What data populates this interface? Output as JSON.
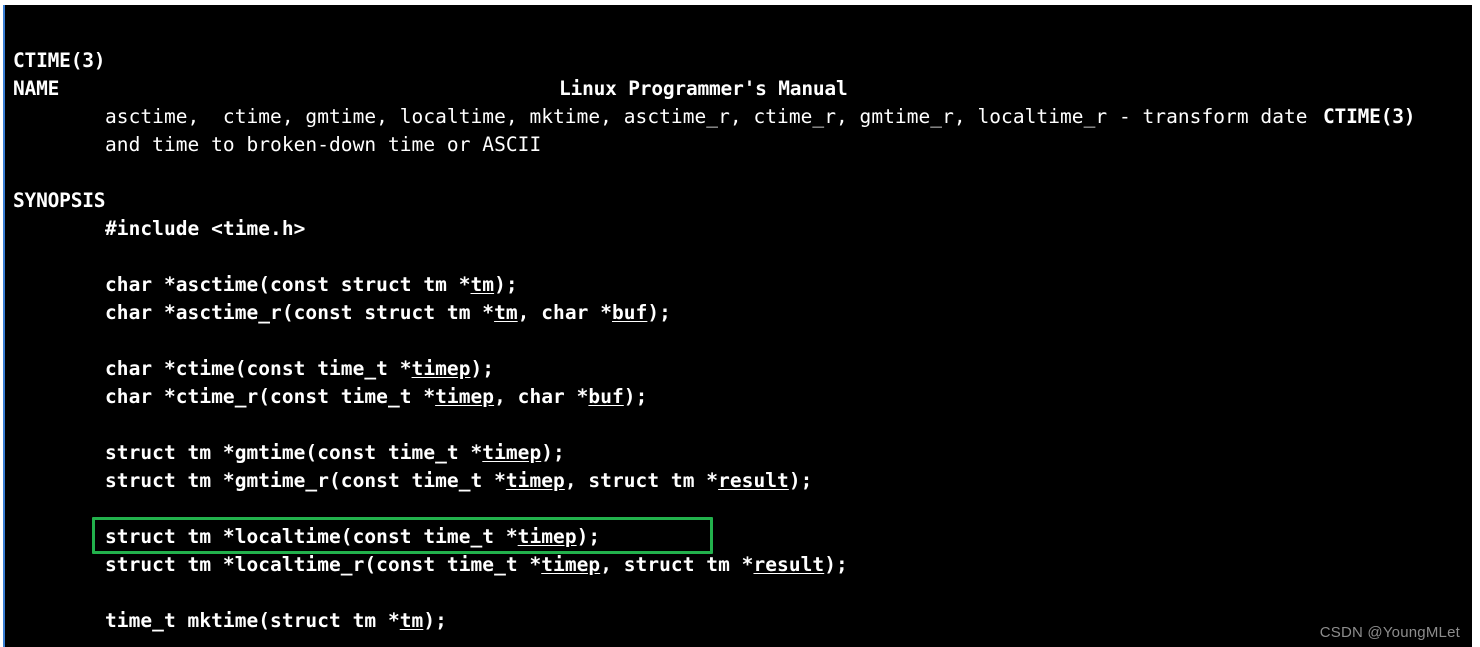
{
  "terminal": {
    "background_color": "#000000",
    "foreground_color": "#ffffff",
    "left_border_color": "#3a7fd5"
  },
  "header": {
    "left": "CTIME(3)",
    "center": "Linux Programmer's Manual",
    "right": "CTIME(3)"
  },
  "sections": {
    "name": {
      "heading": "NAME",
      "lines": [
        "asctime,  ctime, gmtime, localtime, mktime, asctime_r, ctime_r, gmtime_r, localtime_r - transform date",
        "and time to broken-down time or ASCII"
      ]
    },
    "synopsis": {
      "heading": "SYNOPSIS",
      "include": "#include <time.h>",
      "prototypes": [
        {
          "id": "asctime",
          "parts": [
            {
              "text": "char *asctime(const struct tm *",
              "underline": false
            },
            {
              "text": "tm",
              "underline": true
            },
            {
              "text": ");",
              "underline": false
            }
          ]
        },
        {
          "id": "asctime_r",
          "parts": [
            {
              "text": "char *asctime_r(const struct tm *",
              "underline": false
            },
            {
              "text": "tm",
              "underline": true
            },
            {
              "text": ", char *",
              "underline": false
            },
            {
              "text": "buf",
              "underline": true
            },
            {
              "text": ");",
              "underline": false
            }
          ]
        },
        {
          "id": "ctime",
          "parts": [
            {
              "text": "char *ctime(const time_t *",
              "underline": false
            },
            {
              "text": "timep",
              "underline": true
            },
            {
              "text": ");",
              "underline": false
            }
          ]
        },
        {
          "id": "ctime_r",
          "parts": [
            {
              "text": "char *ctime_r(const time_t *",
              "underline": false
            },
            {
              "text": "timep",
              "underline": true
            },
            {
              "text": ", char *",
              "underline": false
            },
            {
              "text": "buf",
              "underline": true
            },
            {
              "text": ");",
              "underline": false
            }
          ]
        },
        {
          "id": "gmtime",
          "parts": [
            {
              "text": "struct tm *gmtime(const time_t *",
              "underline": false
            },
            {
              "text": "timep",
              "underline": true
            },
            {
              "text": ");",
              "underline": false
            }
          ]
        },
        {
          "id": "gmtime_r",
          "parts": [
            {
              "text": "struct tm *gmtime_r(const time_t *",
              "underline": false
            },
            {
              "text": "timep",
              "underline": true
            },
            {
              "text": ", struct tm *",
              "underline": false
            },
            {
              "text": "result",
              "underline": true
            },
            {
              "text": ");",
              "underline": false
            }
          ]
        },
        {
          "id": "localtime",
          "highlighted": true,
          "parts": [
            {
              "text": "struct tm *localtime(const time_t *",
              "underline": false
            },
            {
              "text": "timep",
              "underline": true
            },
            {
              "text": ");",
              "underline": false
            }
          ]
        },
        {
          "id": "localtime_r",
          "parts": [
            {
              "text": "struct tm *localtime_r(const time_t *",
              "underline": false
            },
            {
              "text": "timep",
              "underline": true
            },
            {
              "text": ", struct tm *",
              "underline": false
            },
            {
              "text": "result",
              "underline": true
            },
            {
              "text": ");",
              "underline": false
            }
          ]
        },
        {
          "id": "mktime",
          "parts": [
            {
              "text": "time_t mktime(struct tm *",
              "underline": false
            },
            {
              "text": "tm",
              "underline": true
            },
            {
              "text": ");",
              "underline": false
            }
          ]
        }
      ]
    }
  },
  "annotation": {
    "target": "localtime",
    "color": "#22b14c",
    "shape": "rectangle"
  },
  "watermark": {
    "text": "CSDN @YoungMLet",
    "color": "#8d8d8d"
  }
}
